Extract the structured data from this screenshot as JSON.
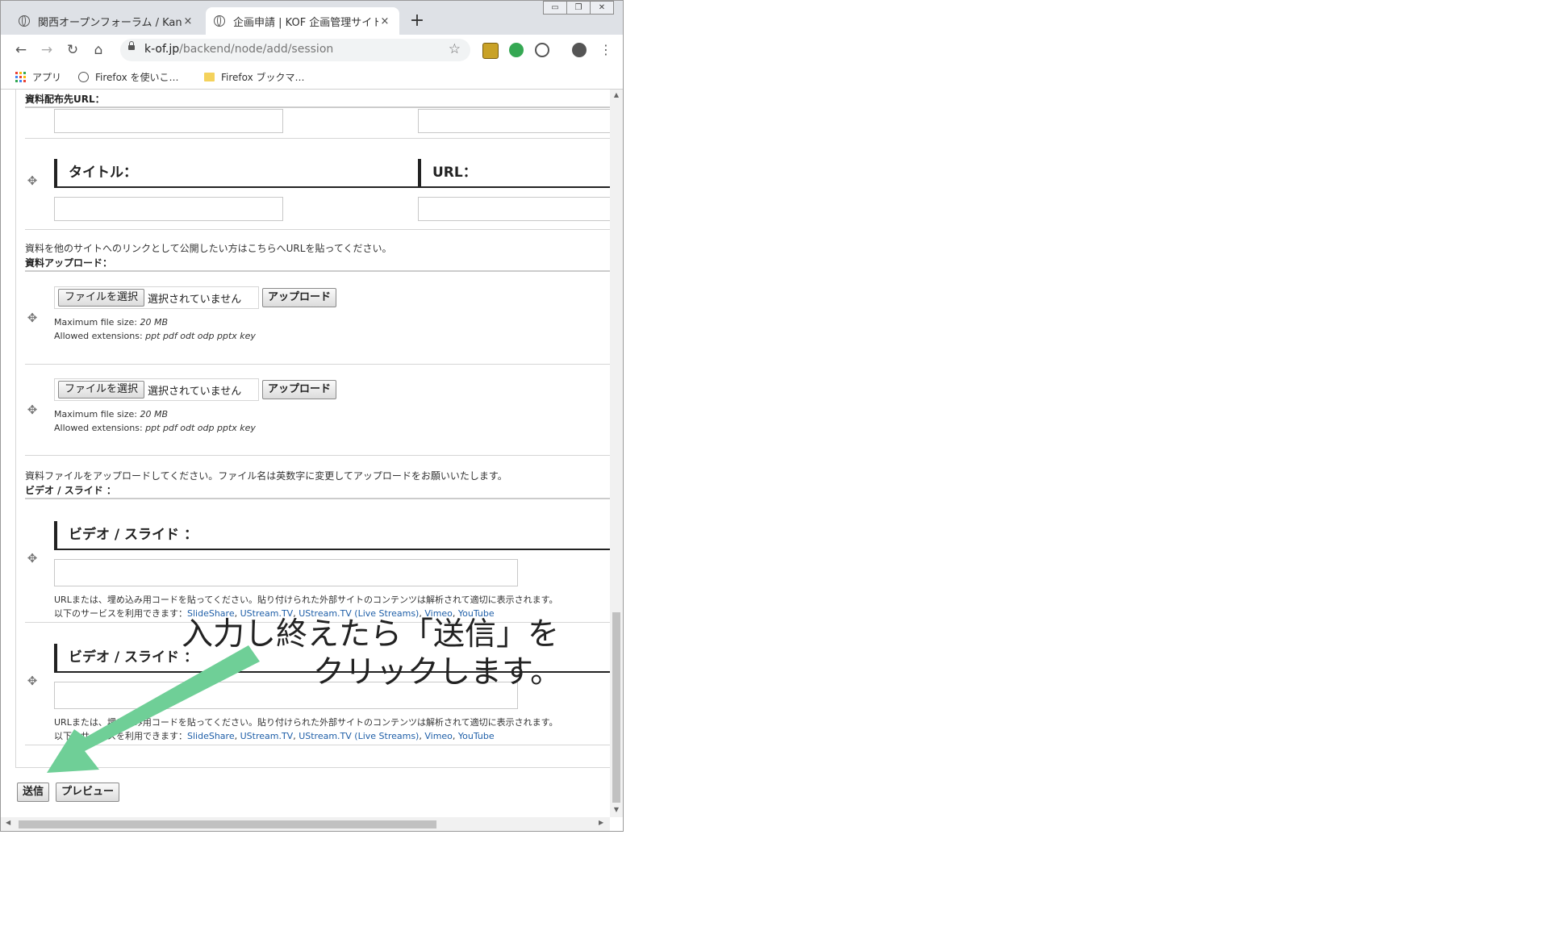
{
  "browser": {
    "tabs": [
      {
        "title": "関西オープンフォーラム / Kans",
        "close": "×",
        "active": false
      },
      {
        "title": "企画申請 | KOF 企画管理サイト",
        "close": "×",
        "active": true
      }
    ],
    "new_tab": "+",
    "window_controls": [
      "▭",
      "❐",
      "✕"
    ],
    "url_host": "k-of.jp",
    "url_path": "/backend/node/add/session",
    "bookmarks": [
      {
        "label": "アプリ",
        "icon": "apps-grid-icon"
      },
      {
        "label": "Firefox を使いこ…",
        "icon": "globe-icon"
      },
      {
        "label": "Firefox ブックマ…",
        "icon": "folder-icon"
      }
    ]
  },
  "form": {
    "material_url_label": "資料配布先URL：",
    "title_heading": "タイトル：",
    "url_heading": "URL：",
    "material_url_help": "資料を他のサイトへのリンクとして公開したい方はこちらへURLを貼ってください。",
    "upload_label": "資料アップロード：",
    "file_rows": [
      {
        "choose": "ファイルを選択",
        "status": "選択されていません",
        "upload": "アップロード",
        "max_size_label": "Maximum file size: ",
        "max_size": "20 MB",
        "ext_label": "Allowed extensions: ",
        "extensions": "ppt pdf odt odp pptx key"
      },
      {
        "choose": "ファイルを選択",
        "status": "選択されていません",
        "upload": "アップロード",
        "max_size_label": "Maximum file size: ",
        "max_size": "20 MB",
        "ext_label": "Allowed extensions: ",
        "extensions": "ppt pdf odt odp pptx key"
      }
    ],
    "upload_help": "資料ファイルをアップロードしてください。ファイル名は英数字に変更してアップロードをお願いいたします。",
    "video_label": "ビデオ / スライド ：",
    "video_rows": [
      {
        "heading": "ビデオ / スライド ：",
        "help": "URLまたは、埋め込み用コードを貼ってください。貼り付けられた外部サイトのコンテンツは解析されて適切に表示されます。",
        "services_prefix": "以下のサービスを利用できます：",
        "services": [
          "SlideShare",
          "UStream.TV",
          "UStream.TV (Live Streams)",
          "Vimeo",
          "YouTube"
        ]
      },
      {
        "heading": "ビデオ / スライド ：",
        "help": "URLまたは、埋め込み用コードを貼ってください。貼り付けられた外部サイトのコンテンツは解析されて適切に表示されます。",
        "services_prefix": "以下のサービスを利用できます：",
        "services": [
          "SlideShare",
          "UStream.TV",
          "UStream.TV (Live Streams)",
          "Vimeo",
          "YouTube"
        ]
      }
    ],
    "submit": "送信",
    "preview": "プレビュー"
  },
  "annotation": {
    "line1": "入力し終えたら「送信」を",
    "line2": "クリックします。",
    "arrow_color": "#6fcf97"
  }
}
